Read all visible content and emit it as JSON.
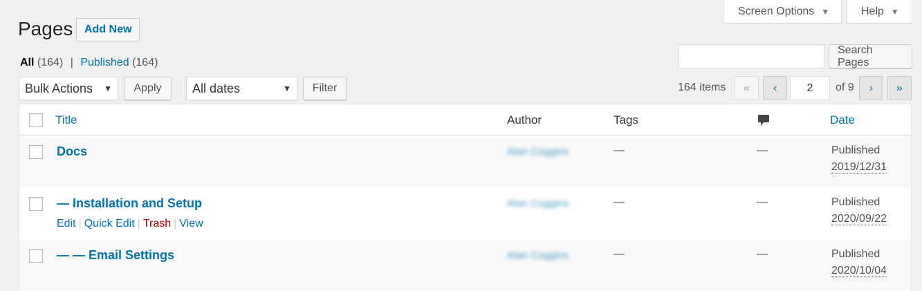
{
  "header": {
    "screen_options": "Screen Options",
    "help": "Help",
    "title": "Pages",
    "add_new": "Add New"
  },
  "filters": {
    "all_label": "All",
    "all_count": "(164)",
    "separator": "|",
    "published_label": "Published",
    "published_count": "(164)"
  },
  "search": {
    "value": "",
    "button": "Search Pages"
  },
  "toolbar": {
    "bulk_actions": "Bulk Actions",
    "apply": "Apply",
    "dates": "All dates",
    "filter": "Filter"
  },
  "pagination": {
    "items": "164 items",
    "first": "«",
    "prev": "‹",
    "current": "2",
    "of_total": "of 9",
    "next": "›",
    "last": "»"
  },
  "table": {
    "columns": {
      "title": "Title",
      "author": "Author",
      "tags": "Tags",
      "date": "Date"
    },
    "rows": [
      {
        "title": "Docs",
        "author": "Alan Coggins",
        "tags": "—",
        "comments": "—",
        "status": "Published",
        "date": "2019/12/31"
      },
      {
        "title": "— Installation and Setup",
        "author": "Alan Coggins",
        "tags": "—",
        "comments": "—",
        "status": "Published",
        "date": "2020/09/22",
        "actions": {
          "edit": "Edit",
          "quick_edit": "Quick Edit",
          "trash": "Trash",
          "view": "View",
          "sep": "|"
        }
      },
      {
        "title": "— — Email Settings",
        "author": "Alan Coggins",
        "tags": "—",
        "comments": "—",
        "status": "Published",
        "date": "2020/10/04"
      }
    ]
  },
  "colors": {
    "link": "#0073aa",
    "trash": "#aa0000",
    "bg": "#f1f1f1"
  }
}
